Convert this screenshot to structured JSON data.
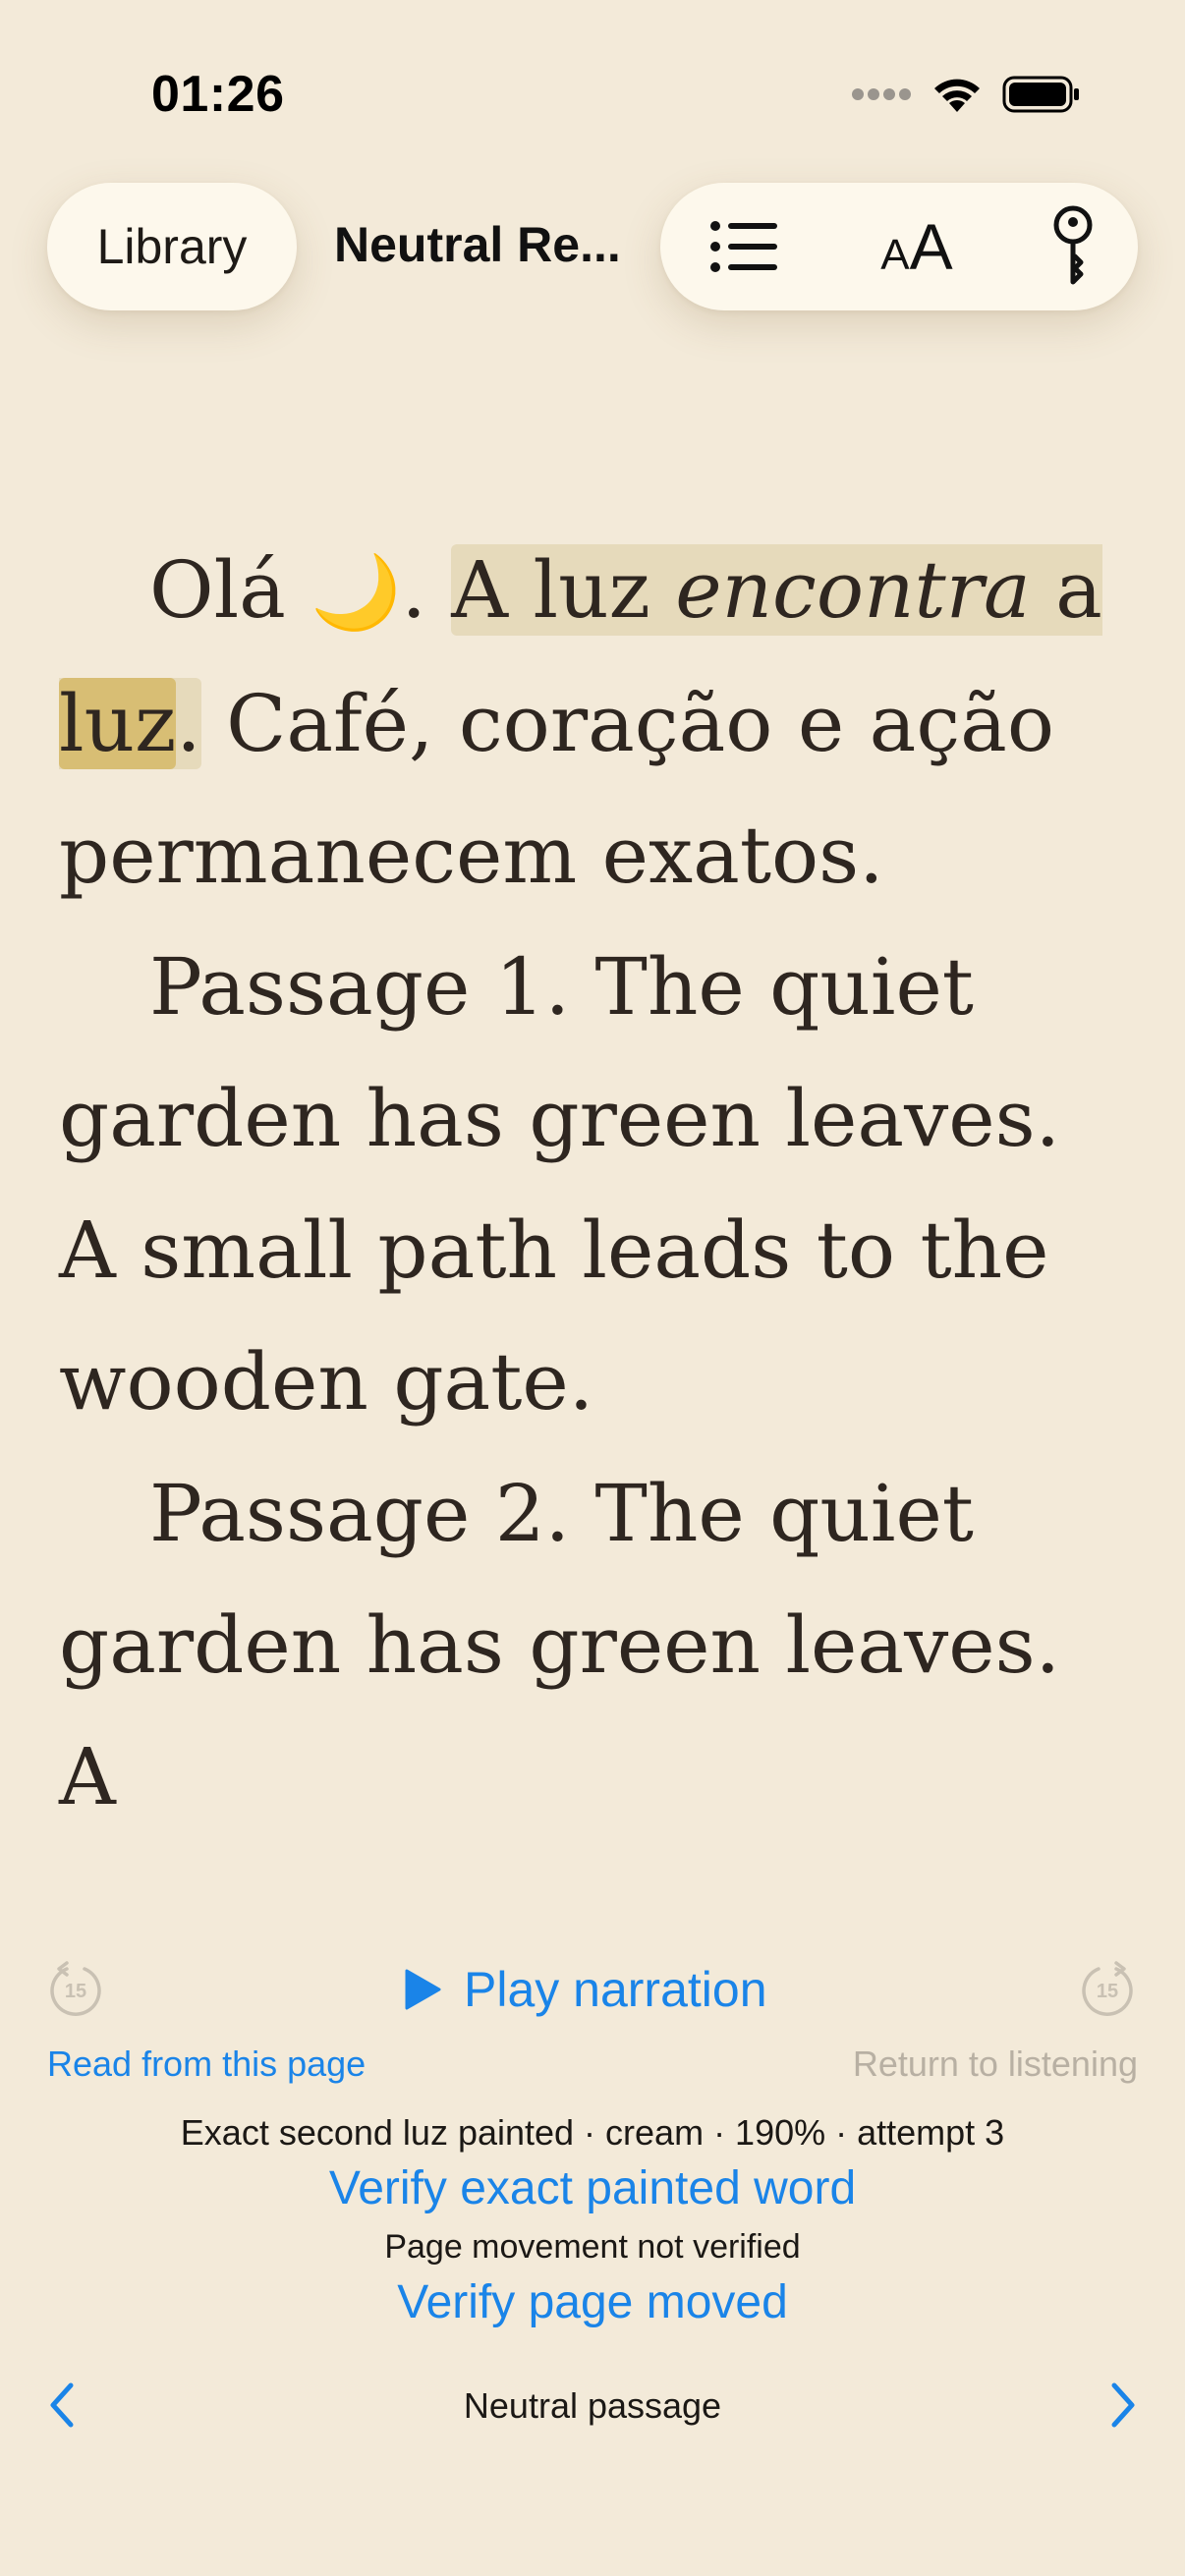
{
  "status_bar": {
    "time": "01:26",
    "icons": [
      "cellular-signal-icon",
      "wifi-icon",
      "battery-icon"
    ]
  },
  "header": {
    "library_label": "Library",
    "book_title": "Neutral Re...",
    "icons": [
      "list-icon",
      "font-size-icon",
      "key-icon"
    ],
    "font_icon_small": "A",
    "font_icon_big": "A"
  },
  "reader": {
    "p1": {
      "t1": "Olá ",
      "emoji": "🌙",
      "t2": ". ",
      "s1": "A luz ",
      "s1_em": "encontra",
      "s1b": " a ",
      "word": "luz",
      "s1c": ".",
      "t3": " Café, coração e ação permanecem exatos."
    },
    "p2": "Passage 1. The quiet garden has green leaves. A small path leads to the wooden gate.",
    "p3": "Passage 2. The quiet garden has green leaves. A"
  },
  "player": {
    "skip_back_label": "15",
    "skip_forward_label": "15",
    "play_label": "Play narration",
    "read_from_page": "Read from this page",
    "return_to_listening": "Return to listening",
    "status": "Exact second luz painted · cream · 190% · attempt 3",
    "verify_word": "Verify exact painted word",
    "movement_status": "Page movement not verified",
    "verify_page": "Verify page moved"
  },
  "footer": {
    "chapter": "Neutral passage"
  },
  "colors": {
    "background": "#F3EAD9",
    "accent": "#1A84E8",
    "sentence_highlight": "#E6DABB",
    "word_highlight": "#D8BE74",
    "disabled": "#B8B0A3"
  }
}
